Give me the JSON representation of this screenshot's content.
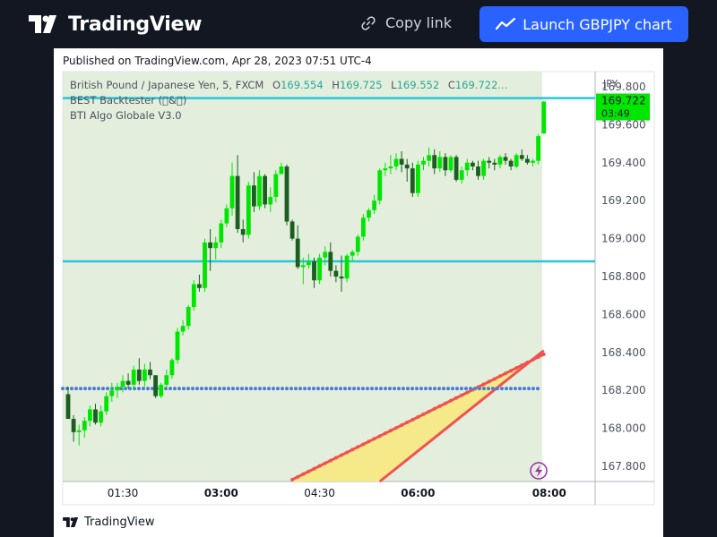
{
  "header": {
    "logo_text": "TradingView",
    "copy_link_label": "Copy link",
    "launch_label": "Launch GBPJPY chart"
  },
  "published": "Published on TradingView.com, Apr 28, 2023 07:51 UTC-4",
  "legend": {
    "symbol": "British Pound / Japanese Yen, 5, FXCM",
    "open_label": "O",
    "open_value": "169.554",
    "high_label": "H",
    "high_value": "169.725",
    "low_label": "L",
    "low_value": "169.552",
    "close_label": "C",
    "close_value": "169.722...",
    "indicator1": "BEST Backtester (\u0000&\u0000)",
    "indicator2": "BTI Algo Globale V3.0"
  },
  "footer": {
    "logo_text": "TradingView"
  },
  "colors": {
    "up": "#00e600",
    "down": "#1b5e20",
    "background": "#e3efdc",
    "cyan_line": "#26c6da",
    "blue_dots": "#4a7bd8",
    "red_line": "#ef5350",
    "band_fill": "#f5e98a",
    "last_price_bg": "#00e600"
  },
  "chart_data": {
    "type": "candlestick",
    "symbol": "GBPJPY",
    "currency_label": "JPY",
    "y_ticks": [
      "167.800",
      "168.000",
      "168.200",
      "168.400",
      "168.600",
      "168.800",
      "169.000",
      "169.200",
      "169.400",
      "169.600",
      "169.800"
    ],
    "x_ticks": [
      {
        "label": "01:30",
        "bold": false,
        "index": 10
      },
      {
        "label": "03:00",
        "bold": true,
        "index": 28
      },
      {
        "label": "04:30",
        "bold": false,
        "index": 46
      },
      {
        "label": "06:00",
        "bold": true,
        "index": 64
      },
      {
        "label": "08:00",
        "bold": true,
        "index": 88
      }
    ],
    "ylim": [
      167.72,
      169.88
    ],
    "last_price": "169.722",
    "countdown": "03:49",
    "horizontal_lines": [
      {
        "name": "cyan-top",
        "value": 169.74,
        "style": "solid"
      },
      {
        "name": "cyan-mid",
        "value": 168.88,
        "style": "solid"
      },
      {
        "name": "blue-dotted",
        "value": 168.21,
        "style": "dotted"
      }
    ],
    "lower_band": {
      "from_index": 41,
      "start_value": 167.73,
      "end_value": 168.39
    },
    "upper_band": {
      "from_index": 57,
      "start_value": 167.72,
      "end_value": 168.41
    },
    "candles": [
      {
        "o": 168.18,
        "h": 168.22,
        "l": 168.06,
        "c": 168.05
      },
      {
        "o": 168.05,
        "h": 168.07,
        "l": 167.93,
        "c": 167.98
      },
      {
        "o": 167.98,
        "h": 168.02,
        "l": 167.91,
        "c": 167.99
      },
      {
        "o": 167.99,
        "h": 168.06,
        "l": 167.95,
        "c": 168.04
      },
      {
        "o": 168.04,
        "h": 168.12,
        "l": 168.01,
        "c": 168.1
      },
      {
        "o": 168.1,
        "h": 168.13,
        "l": 168.02,
        "c": 168.03
      },
      {
        "o": 168.03,
        "h": 168.12,
        "l": 168.01,
        "c": 168.09
      },
      {
        "o": 168.09,
        "h": 168.19,
        "l": 168.07,
        "c": 168.17
      },
      {
        "o": 168.17,
        "h": 168.24,
        "l": 168.14,
        "c": 168.2
      },
      {
        "o": 168.2,
        "h": 168.24,
        "l": 168.16,
        "c": 168.22
      },
      {
        "o": 168.22,
        "h": 168.28,
        "l": 168.19,
        "c": 168.25
      },
      {
        "o": 168.25,
        "h": 168.29,
        "l": 168.21,
        "c": 168.23
      },
      {
        "o": 168.23,
        "h": 168.33,
        "l": 168.21,
        "c": 168.31
      },
      {
        "o": 168.31,
        "h": 168.37,
        "l": 168.23,
        "c": 168.25
      },
      {
        "o": 168.25,
        "h": 168.34,
        "l": 168.22,
        "c": 168.31
      },
      {
        "o": 168.31,
        "h": 168.35,
        "l": 168.26,
        "c": 168.28
      },
      {
        "o": 168.28,
        "h": 168.28,
        "l": 168.16,
        "c": 168.17
      },
      {
        "o": 168.17,
        "h": 168.24,
        "l": 168.16,
        "c": 168.23
      },
      {
        "o": 168.23,
        "h": 168.31,
        "l": 168.21,
        "c": 168.28
      },
      {
        "o": 168.28,
        "h": 168.37,
        "l": 168.26,
        "c": 168.36
      },
      {
        "o": 168.36,
        "h": 168.53,
        "l": 168.34,
        "c": 168.51
      },
      {
        "o": 168.51,
        "h": 168.57,
        "l": 168.49,
        "c": 168.54
      },
      {
        "o": 168.54,
        "h": 168.65,
        "l": 168.52,
        "c": 168.64
      },
      {
        "o": 168.64,
        "h": 168.78,
        "l": 168.62,
        "c": 168.76
      },
      {
        "o": 168.76,
        "h": 168.81,
        "l": 168.72,
        "c": 168.74
      },
      {
        "o": 168.74,
        "h": 169.0,
        "l": 168.72,
        "c": 168.98
      },
      {
        "o": 168.98,
        "h": 169.05,
        "l": 168.83,
        "c": 168.95
      },
      {
        "o": 168.95,
        "h": 169.01,
        "l": 168.89,
        "c": 168.98
      },
      {
        "o": 168.98,
        "h": 169.1,
        "l": 168.95,
        "c": 169.08
      },
      {
        "o": 169.08,
        "h": 169.18,
        "l": 169.06,
        "c": 169.16
      },
      {
        "o": 169.16,
        "h": 169.4,
        "l": 169.12,
        "c": 169.33
      },
      {
        "o": 169.33,
        "h": 169.44,
        "l": 169.03,
        "c": 169.05
      },
      {
        "o": 169.05,
        "h": 169.1,
        "l": 168.98,
        "c": 169.02
      },
      {
        "o": 169.02,
        "h": 169.3,
        "l": 169.0,
        "c": 169.28
      },
      {
        "o": 169.28,
        "h": 169.35,
        "l": 169.14,
        "c": 169.17
      },
      {
        "o": 169.17,
        "h": 169.36,
        "l": 169.15,
        "c": 169.33
      },
      {
        "o": 169.33,
        "h": 169.34,
        "l": 169.16,
        "c": 169.18
      },
      {
        "o": 169.18,
        "h": 169.27,
        "l": 169.14,
        "c": 169.22
      },
      {
        "o": 169.22,
        "h": 169.36,
        "l": 169.19,
        "c": 169.34
      },
      {
        "o": 169.34,
        "h": 169.4,
        "l": 169.36,
        "c": 169.38
      },
      {
        "o": 169.38,
        "h": 169.39,
        "l": 169.07,
        "c": 169.09
      },
      {
        "o": 169.09,
        "h": 169.1,
        "l": 168.99,
        "c": 169.0
      },
      {
        "o": 169.0,
        "h": 169.07,
        "l": 168.84,
        "c": 168.85
      },
      {
        "o": 168.85,
        "h": 168.9,
        "l": 168.76,
        "c": 168.86
      },
      {
        "o": 168.86,
        "h": 168.92,
        "l": 168.84,
        "c": 168.88
      },
      {
        "o": 168.88,
        "h": 168.9,
        "l": 168.74,
        "c": 168.78
      },
      {
        "o": 168.78,
        "h": 168.92,
        "l": 168.76,
        "c": 168.9
      },
      {
        "o": 168.9,
        "h": 168.96,
        "l": 168.86,
        "c": 168.93
      },
      {
        "o": 168.93,
        "h": 168.98,
        "l": 168.8,
        "c": 168.83
      },
      {
        "o": 168.83,
        "h": 168.86,
        "l": 168.77,
        "c": 168.8
      },
      {
        "o": 168.8,
        "h": 168.91,
        "l": 168.72,
        "c": 168.79
      },
      {
        "o": 168.79,
        "h": 168.92,
        "l": 168.77,
        "c": 168.91
      },
      {
        "o": 168.91,
        "h": 168.94,
        "l": 168.88,
        "c": 168.93
      },
      {
        "o": 168.93,
        "h": 169.02,
        "l": 168.91,
        "c": 169.01
      },
      {
        "o": 169.01,
        "h": 169.13,
        "l": 168.99,
        "c": 169.11
      },
      {
        "o": 169.11,
        "h": 169.16,
        "l": 169.09,
        "c": 169.15
      },
      {
        "o": 169.15,
        "h": 169.23,
        "l": 169.13,
        "c": 169.2
      },
      {
        "o": 169.2,
        "h": 169.37,
        "l": 169.18,
        "c": 169.36
      },
      {
        "o": 169.36,
        "h": 169.4,
        "l": 169.33,
        "c": 169.37
      },
      {
        "o": 169.37,
        "h": 169.44,
        "l": 169.34,
        "c": 169.38
      },
      {
        "o": 169.38,
        "h": 169.45,
        "l": 169.36,
        "c": 169.42
      },
      {
        "o": 169.42,
        "h": 169.46,
        "l": 169.35,
        "c": 169.39
      },
      {
        "o": 169.39,
        "h": 169.42,
        "l": 169.3,
        "c": 169.37
      },
      {
        "o": 169.37,
        "h": 169.4,
        "l": 169.22,
        "c": 169.24
      },
      {
        "o": 169.24,
        "h": 169.41,
        "l": 169.22,
        "c": 169.39
      },
      {
        "o": 169.39,
        "h": 169.43,
        "l": 169.36,
        "c": 169.41
      },
      {
        "o": 169.41,
        "h": 169.48,
        "l": 169.38,
        "c": 169.44
      },
      {
        "o": 169.44,
        "h": 169.47,
        "l": 169.34,
        "c": 169.37
      },
      {
        "o": 169.37,
        "h": 169.46,
        "l": 169.35,
        "c": 169.43
      },
      {
        "o": 169.43,
        "h": 169.45,
        "l": 169.33,
        "c": 169.36
      },
      {
        "o": 169.36,
        "h": 169.44,
        "l": 169.35,
        "c": 169.43
      },
      {
        "o": 169.43,
        "h": 169.44,
        "l": 169.3,
        "c": 169.31
      },
      {
        "o": 169.31,
        "h": 169.38,
        "l": 169.29,
        "c": 169.36
      },
      {
        "o": 169.36,
        "h": 169.42,
        "l": 169.33,
        "c": 169.4
      },
      {
        "o": 169.4,
        "h": 169.41,
        "l": 169.36,
        "c": 169.38
      },
      {
        "o": 169.38,
        "h": 169.41,
        "l": 169.31,
        "c": 169.33
      },
      {
        "o": 169.33,
        "h": 169.42,
        "l": 169.31,
        "c": 169.41
      },
      {
        "o": 169.41,
        "h": 169.43,
        "l": 169.37,
        "c": 169.4
      },
      {
        "o": 169.4,
        "h": 169.42,
        "l": 169.36,
        "c": 169.39
      },
      {
        "o": 169.39,
        "h": 169.44,
        "l": 169.37,
        "c": 169.43
      },
      {
        "o": 169.43,
        "h": 169.45,
        "l": 169.39,
        "c": 169.41
      },
      {
        "o": 169.41,
        "h": 169.42,
        "l": 169.36,
        "c": 169.38
      },
      {
        "o": 169.38,
        "h": 169.45,
        "l": 169.37,
        "c": 169.44
      },
      {
        "o": 169.44,
        "h": 169.47,
        "l": 169.41,
        "c": 169.42
      },
      {
        "o": 169.42,
        "h": 169.44,
        "l": 169.39,
        "c": 169.4
      },
      {
        "o": 169.4,
        "h": 169.42,
        "l": 169.38,
        "c": 169.41
      },
      {
        "o": 169.41,
        "h": 169.55,
        "l": 169.39,
        "c": 169.54
      },
      {
        "o": 169.554,
        "h": 169.725,
        "l": 169.552,
        "c": 169.722
      }
    ]
  }
}
